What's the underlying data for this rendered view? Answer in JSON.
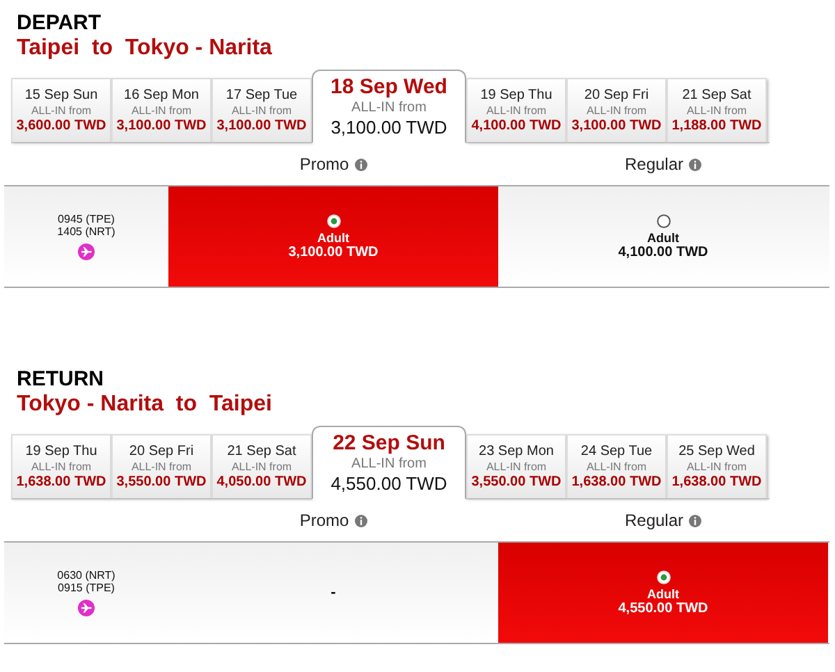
{
  "sections": [
    {
      "title": "DEPART",
      "route": "Taipei  to  Tokyo - Narita",
      "dates": [
        {
          "date": "15 Sep Sun",
          "note": "ALL-IN from",
          "price": "3,600.00 TWD",
          "selected": false
        },
        {
          "date": "16 Sep Mon",
          "note": "ALL-IN from",
          "price": "3,100.00 TWD",
          "selected": false
        },
        {
          "date": "17 Sep Tue",
          "note": "ALL-IN from",
          "price": "3,100.00 TWD",
          "selected": false
        },
        {
          "date": "18 Sep Wed",
          "note": "ALL-IN from",
          "price": "3,100.00 TWD",
          "selected": true
        },
        {
          "date": "19 Sep Thu",
          "note": "ALL-IN from",
          "price": "4,100.00 TWD",
          "selected": false
        },
        {
          "date": "20 Sep Fri",
          "note": "ALL-IN from",
          "price": "3,100.00 TWD",
          "selected": false
        },
        {
          "date": "21 Sep Sat",
          "note": "ALL-IN from",
          "price": "1,188.00 TWD",
          "selected": false
        }
      ],
      "fare_columns": [
        "Promo",
        "Regular"
      ],
      "flight": {
        "departure": "0945  (TPE)",
        "arrival": "1405  (NRT)"
      },
      "fares": [
        {
          "kind": "fare",
          "label": "Adult",
          "price": "3,100.00 TWD",
          "selected": true
        },
        {
          "kind": "fare",
          "label": "Adult",
          "price": "4,100.00 TWD",
          "selected": false
        }
      ]
    },
    {
      "title": "RETURN",
      "route": "Tokyo - Narita  to  Taipei",
      "dates": [
        {
          "date": "19 Sep Thu",
          "note": "ALL-IN from",
          "price": "1,638.00 TWD",
          "selected": false
        },
        {
          "date": "20 Sep Fri",
          "note": "ALL-IN from",
          "price": "3,550.00 TWD",
          "selected": false
        },
        {
          "date": "21 Sep Sat",
          "note": "ALL-IN from",
          "price": "4,050.00 TWD",
          "selected": false
        },
        {
          "date": "22 Sep Sun",
          "note": "ALL-IN from",
          "price": "4,550.00 TWD",
          "selected": true
        },
        {
          "date": "23 Sep Mon",
          "note": "ALL-IN from",
          "price": "3,550.00 TWD",
          "selected": false
        },
        {
          "date": "24 Sep Tue",
          "note": "ALL-IN from",
          "price": "1,638.00 TWD",
          "selected": false
        },
        {
          "date": "25 Sep Wed",
          "note": "ALL-IN from",
          "price": "1,638.00 TWD",
          "selected": false
        }
      ],
      "fare_columns": [
        "Promo",
        "Regular"
      ],
      "flight": {
        "departure": "0630  (NRT)",
        "arrival": "0915  (TPE)"
      },
      "fares": [
        {
          "kind": "none",
          "text": "-"
        },
        {
          "kind": "fare",
          "label": "Adult",
          "price": "4,550.00 TWD",
          "selected": true
        }
      ]
    }
  ]
}
